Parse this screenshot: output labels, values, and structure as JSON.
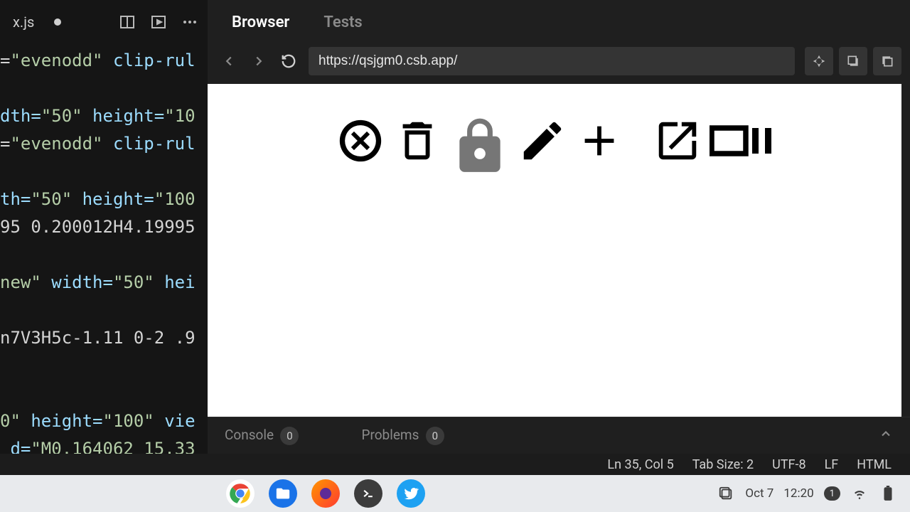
{
  "editor": {
    "tab_name": "x.js",
    "dirty": true,
    "code_lines": [
      {
        "segments": [
          {
            "t": "=",
            "c": "txt"
          },
          {
            "t": "\"evenodd\"",
            "c": "str"
          },
          {
            "t": " clip-rul",
            "c": "attr"
          }
        ]
      },
      {
        "segments": []
      },
      {
        "segments": [
          {
            "t": "dth=",
            "c": "attr"
          },
          {
            "t": "\"50\"",
            "c": "str"
          },
          {
            "t": " height=",
            "c": "attr"
          },
          {
            "t": "\"10",
            "c": "str"
          }
        ]
      },
      {
        "segments": [
          {
            "t": "=",
            "c": "txt"
          },
          {
            "t": "\"evenodd\"",
            "c": "str"
          },
          {
            "t": " clip-rul",
            "c": "attr"
          }
        ]
      },
      {
        "segments": []
      },
      {
        "segments": [
          {
            "t": "th=",
            "c": "attr"
          },
          {
            "t": "\"50\"",
            "c": "str"
          },
          {
            "t": " height=",
            "c": "attr"
          },
          {
            "t": "\"100",
            "c": "str"
          }
        ]
      },
      {
        "segments": [
          {
            "t": "95 0.200012H4.19995",
            "c": "txt"
          }
        ]
      },
      {
        "segments": []
      },
      {
        "segments": [
          {
            "t": "new\"",
            "c": "str"
          },
          {
            "t": " width=",
            "c": "attr"
          },
          {
            "t": "\"50\"",
            "c": "str"
          },
          {
            "t": " hei",
            "c": "attr"
          }
        ]
      },
      {
        "segments": []
      },
      {
        "segments": [
          {
            "t": "n7V3H5c-1.11 0-2 .9",
            "c": "txt"
          }
        ]
      },
      {
        "segments": []
      },
      {
        "segments": []
      },
      {
        "segments": [
          {
            "t": "0\"",
            "c": "str"
          },
          {
            "t": " height=",
            "c": "attr"
          },
          {
            "t": "\"100\"",
            "c": "str"
          },
          {
            "t": " vie",
            "c": "attr"
          }
        ]
      },
      {
        "segments": [
          {
            "t": " d=",
            "c": "attr"
          },
          {
            "t": "\"M0.164062 15.33",
            "c": "str"
          }
        ]
      }
    ]
  },
  "right": {
    "tabs": [
      {
        "label": "Browser",
        "active": true
      },
      {
        "label": "Tests",
        "active": false
      }
    ],
    "url": "https://qsjgm0.csb.app/"
  },
  "preview_icons": [
    "cancel-circle-icon",
    "delete-icon",
    "lock-icon",
    "edit-icon",
    "plus-icon",
    "open-in-new-icon",
    "burst-mode-icon"
  ],
  "console": {
    "items": [
      {
        "label": "Console",
        "count": "0"
      },
      {
        "label": "Problems",
        "count": "0"
      }
    ]
  },
  "status": {
    "position": "Ln 35, Col 5",
    "tab_size": "Tab Size: 2",
    "encoding": "UTF-8",
    "eol": "LF",
    "lang": "HTML"
  },
  "taskbar": {
    "date": "Oct 7",
    "time": "12:20",
    "notif": "1"
  }
}
